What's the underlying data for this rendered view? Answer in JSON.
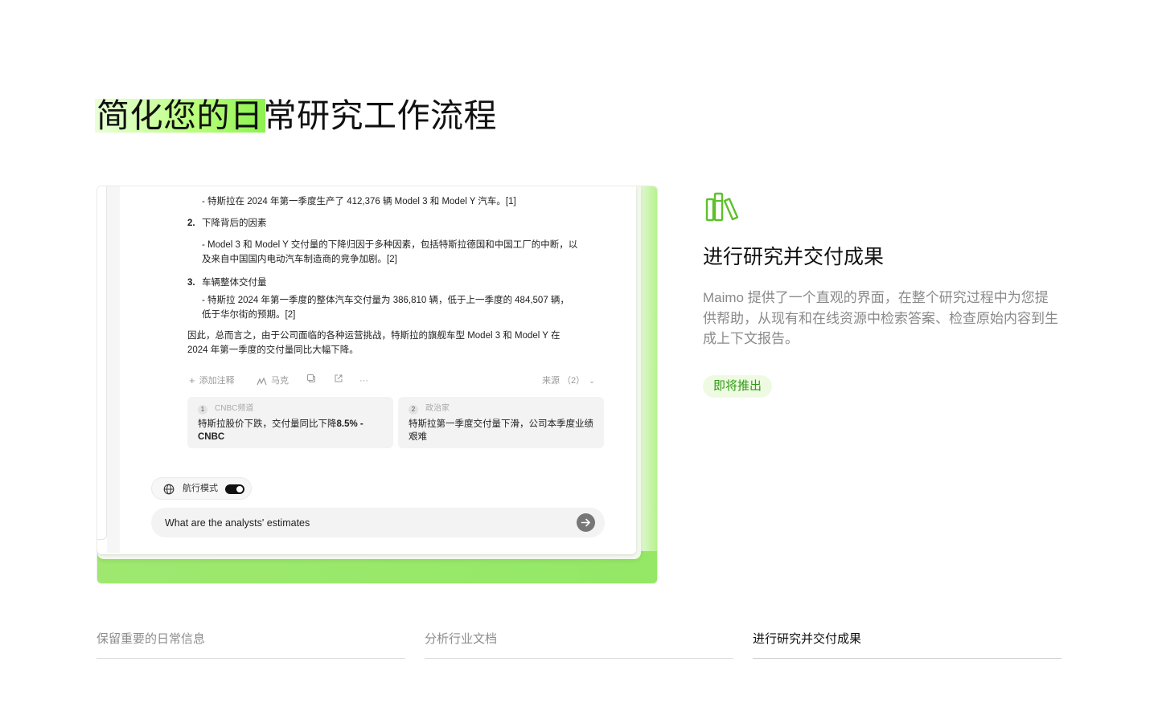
{
  "hero": {
    "title_highlight": "简化您的日",
    "title_rest": "常研究工作流程"
  },
  "screenshot": {
    "lines": {
      "b1": "- 特斯拉在 2024 年第一季度生产了 412,376 辆 Model 3 和 Model Y 汽车。[1]",
      "n2": "2.",
      "n2_label": "下降背后的因素",
      "b2a": "- Model 3 和 Model Y 交付量的下降归因于多种因素，包括特斯拉德国和中国工厂的中断，以",
      "b2b": "及来自中国国内电动汽车制造商的竞争加剧。[2]",
      "n3": "3.",
      "n3_label": "车辆整体交付量",
      "b3a": "- 特斯拉 2024 年第一季度的整体汽车交付量为 386,810 辆，低于上一季度的 484,507 辆，",
      "b3b": "低于华尔街的预期。[2]",
      "c1": "因此，总而言之，由于公司面临的各种运营挑战，特斯拉的旗舰车型 Model 3 和 Model Y 在",
      "c2": "2024 年第一季度的交付量同比大幅下降。"
    },
    "toolbar": {
      "add_note": "添加注释",
      "mark": "马克",
      "more": "···",
      "sources": "来源 （2）"
    },
    "sources": [
      {
        "index": "1",
        "name": "CNBC频道",
        "title_a": "特斯拉股价下跌，交付量同比下降",
        "title_b": "8.5% - CNBC"
      },
      {
        "index": "2",
        "name": "政治家",
        "title_a": "特斯拉第一季度交付量下滑，公司本季度业绩艰难",
        "title_b": ""
      }
    ],
    "nav_mode_label": "航行模式",
    "nav_mode_on": true,
    "chat_input_value": "What are the analysts' estimates"
  },
  "feature": {
    "icon": "books-icon",
    "title": "进行研究并交付成果",
    "description": "Maimo 提供了一个直观的界面，在整个研究过程中为您提供帮助，从现有和在线资源中检索答案、检查原始内容到生成上下文报告。",
    "badge": "即将推出",
    "accent": "#5fc02c"
  },
  "tabs": [
    {
      "label": "保留重要的日常信息",
      "active": false
    },
    {
      "label": "分析行业文档",
      "active": false
    },
    {
      "label": "进行研究并交付成果",
      "active": true
    }
  ]
}
